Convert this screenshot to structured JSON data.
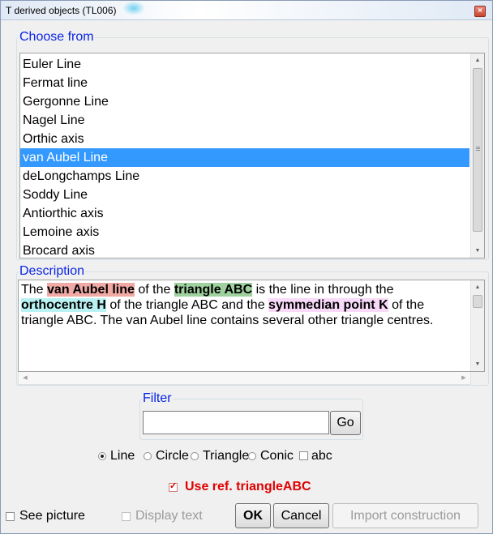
{
  "window": {
    "title": "T derived objects (TL006)",
    "close_glyph": "×"
  },
  "choose": {
    "legend": "Choose from",
    "items": [
      "Euler Line",
      "Fermat line",
      "Gergonne Line",
      "Nagel Line",
      "Orthic axis",
      "van Aubel Line",
      "deLongchamps Line",
      "Soddy Line",
      "Antiorthic axis",
      "Lemoine axis",
      "Brocard axis"
    ],
    "selected_index": 5
  },
  "description": {
    "legend": "Description",
    "parts": [
      {
        "text": "The ",
        "style": ""
      },
      {
        "text": "van Aubel line",
        "style": "red"
      },
      {
        "text": " of the ",
        "style": ""
      },
      {
        "text": "triangle ABC",
        "style": "green"
      },
      {
        "text": " is the line in through the ",
        "style": ""
      },
      {
        "text": "orthocentre H",
        "style": "cyan"
      },
      {
        "text": " of the triangle ABC and the ",
        "style": ""
      },
      {
        "text": "symmedian point K",
        "style": "pink"
      },
      {
        "text": " of the triangle ABC. The van Aubel line contains several other triangle centres.",
        "style": ""
      }
    ],
    "highlight_colors": {
      "red": "#f0a9a4",
      "green": "#9fd19f",
      "cyan": "#b9f2f2",
      "pink": "#f8d9f8"
    }
  },
  "filter": {
    "legend": "Filter",
    "value": "",
    "go_label": "Go"
  },
  "object_types": [
    {
      "label": "Line",
      "kind": "radio",
      "checked": true
    },
    {
      "label": "Circle",
      "kind": "radio",
      "checked": false
    },
    {
      "label": "Triangle",
      "kind": "radio",
      "checked": false
    },
    {
      "label": "Conic",
      "kind": "radio",
      "checked": false
    },
    {
      "label": "abc",
      "kind": "checkbox",
      "checked": false
    }
  ],
  "use_ref": {
    "label": "Use ref. triangleABC",
    "checked": true,
    "color": "#e00000"
  },
  "bottom": {
    "see_picture": {
      "label": "See picture",
      "checked": false
    },
    "display_text": {
      "label": "Display text",
      "checked": false,
      "enabled": false
    },
    "ok_label": "OK",
    "cancel_label": "Cancel",
    "import_label": "Import construction"
  },
  "colors": {
    "selection": "#3399ff",
    "legend": "#0a24e6"
  }
}
